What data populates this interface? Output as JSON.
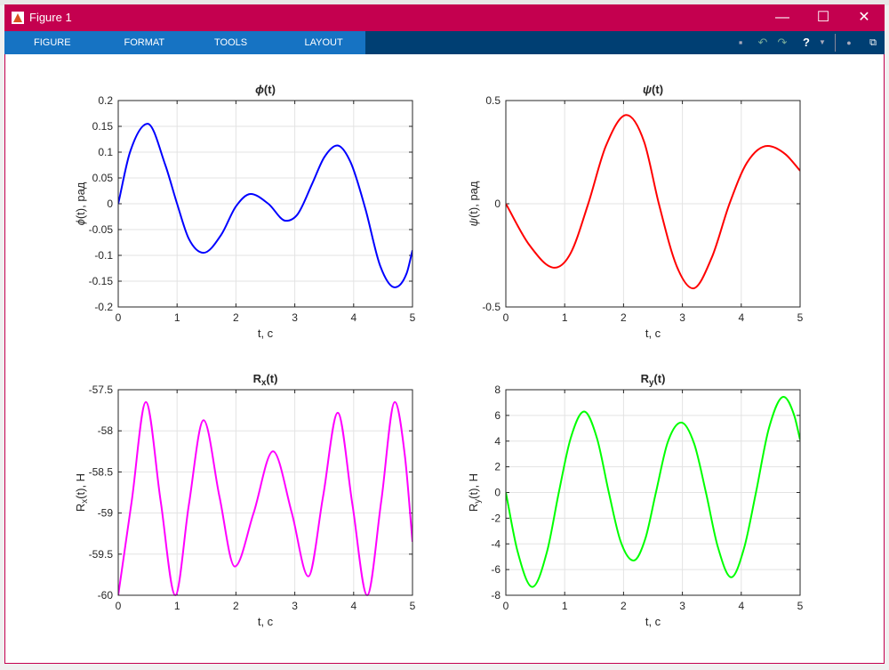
{
  "window": {
    "title": "Figure 1",
    "minimize": "—",
    "maximize": "☐",
    "close": "✕"
  },
  "toolstrip": {
    "tabs": [
      "FIGURE",
      "FORMAT",
      "TOOLS",
      "LAYOUT"
    ],
    "icons": [
      "save-icon",
      "undo-icon",
      "redo-icon",
      "help-icon",
      "dropdown-icon",
      "dock-icon"
    ]
  },
  "colors": {
    "phi": "#0000FF",
    "psi": "#FF0000",
    "rx": "#FF00FF",
    "ry": "#00FF00",
    "titlebar": "#C4004F"
  },
  "chart_data": [
    {
      "type": "line",
      "title": {
        "main": "ϕ",
        "sub": "",
        "tail": "(t)"
      },
      "xlabel": "t, c",
      "ylabel": {
        "main": "ϕ",
        "sub": "",
        "tail": "(t),  рад"
      },
      "xlim": [
        0,
        5
      ],
      "ylim": [
        -0.2,
        0.2
      ],
      "grid": true,
      "xticks": [
        0,
        1,
        2,
        3,
        4,
        5
      ],
      "xtick_labels": [
        "0",
        "1",
        "2",
        "3",
        "4",
        "5"
      ],
      "yticks": [
        -0.2,
        -0.15,
        -0.1,
        -0.05,
        0,
        0.05,
        0.1,
        0.15,
        0.2
      ],
      "ytick_labels": [
        "-0.2",
        "-0.15",
        "-0.1",
        "-0.05",
        "0",
        "0.05",
        "0.1",
        "0.15",
        "0.2"
      ],
      "color_key": "phi",
      "points": [
        [
          0,
          0
        ],
        [
          0.2,
          0.1
        ],
        [
          0.5,
          0.155
        ],
        [
          0.8,
          0.075
        ],
        [
          1.0,
          0.0
        ],
        [
          1.2,
          -0.068
        ],
        [
          1.45,
          -0.095
        ],
        [
          1.75,
          -0.06
        ],
        [
          2.0,
          -0.005
        ],
        [
          2.25,
          0.019
        ],
        [
          2.55,
          0.0
        ],
        [
          2.85,
          -0.033
        ],
        [
          3.05,
          -0.02
        ],
        [
          3.3,
          0.04
        ],
        [
          3.5,
          0.09
        ],
        [
          3.72,
          0.113
        ],
        [
          3.95,
          0.08
        ],
        [
          4.2,
          -0.01
        ],
        [
          4.45,
          -0.12
        ],
        [
          4.7,
          -0.162
        ],
        [
          4.9,
          -0.135
        ],
        [
          5,
          -0.09
        ]
      ]
    },
    {
      "type": "line",
      "title": {
        "main": "ψ",
        "sub": "",
        "tail": "(t)"
      },
      "xlabel": "t, c",
      "ylabel": {
        "main": "ψ",
        "sub": "",
        "tail": "(t),  рад"
      },
      "xlim": [
        0,
        5
      ],
      "ylim": [
        -0.5,
        0.5
      ],
      "grid": true,
      "xticks": [
        0,
        1,
        2,
        3,
        4,
        5
      ],
      "xtick_labels": [
        "0",
        "1",
        "2",
        "3",
        "4",
        "5"
      ],
      "yticks": [
        -0.5,
        0,
        0.5
      ],
      "ytick_labels": [
        "-0.5",
        "0",
        "0.5"
      ],
      "color_key": "psi",
      "points": [
        [
          0,
          0
        ],
        [
          0.4,
          -0.2
        ],
        [
          0.83,
          -0.31
        ],
        [
          1.1,
          -0.24
        ],
        [
          1.4,
          0
        ],
        [
          1.7,
          0.28
        ],
        [
          2.05,
          0.43
        ],
        [
          2.35,
          0.3
        ],
        [
          2.6,
          0
        ],
        [
          2.9,
          -0.3
        ],
        [
          3.18,
          -0.41
        ],
        [
          3.5,
          -0.26
        ],
        [
          3.8,
          0
        ],
        [
          4.1,
          0.2
        ],
        [
          4.45,
          0.28
        ],
        [
          4.75,
          0.24
        ],
        [
          5,
          0.16
        ]
      ]
    },
    {
      "type": "line",
      "title": {
        "main": "R",
        "sub": "x",
        "tail": "(t)"
      },
      "xlabel": "t, c",
      "ylabel": {
        "main": "R",
        "sub": "x",
        "tail": "(t),  Н"
      },
      "xlim": [
        0,
        5
      ],
      "ylim": [
        -60,
        -57.5
      ],
      "grid": true,
      "xticks": [
        0,
        1,
        2,
        3,
        4,
        5
      ],
      "xtick_labels": [
        "0",
        "1",
        "2",
        "3",
        "4",
        "5"
      ],
      "yticks": [
        -60,
        -59.5,
        -59,
        -58.5,
        -58,
        -57.5
      ],
      "ytick_labels": [
        "-60",
        "-59.5",
        "-59",
        "-58.5",
        "-58",
        "-57.5"
      ],
      "color_key": "rx",
      "points": [
        [
          0,
          -60
        ],
        [
          0.23,
          -58.85
        ],
        [
          0.47,
          -57.65
        ],
        [
          0.72,
          -58.85
        ],
        [
          0.97,
          -60
        ],
        [
          1.2,
          -58.9
        ],
        [
          1.45,
          -57.87
        ],
        [
          1.72,
          -58.8
        ],
        [
          1.98,
          -59.65
        ],
        [
          2.3,
          -59.0
        ],
        [
          2.63,
          -58.25
        ],
        [
          2.95,
          -59.0
        ],
        [
          3.23,
          -59.77
        ],
        [
          3.48,
          -58.8
        ],
        [
          3.73,
          -57.78
        ],
        [
          3.98,
          -58.9
        ],
        [
          4.23,
          -60
        ],
        [
          4.47,
          -58.85
        ],
        [
          4.7,
          -57.65
        ],
        [
          4.87,
          -58.3
        ],
        [
          5,
          -59.35
        ]
      ]
    },
    {
      "type": "line",
      "title": {
        "main": "R",
        "sub": "y",
        "tail": "(t)"
      },
      "xlabel": "t, c",
      "ylabel": {
        "main": "R",
        "sub": "y",
        "tail": "(t),  Н"
      },
      "xlim": [
        0,
        5
      ],
      "ylim": [
        -8,
        8
      ],
      "grid": true,
      "xticks": [
        0,
        1,
        2,
        3,
        4,
        5
      ],
      "xtick_labels": [
        "0",
        "1",
        "2",
        "3",
        "4",
        "5"
      ],
      "yticks": [
        -8,
        -6,
        -4,
        -2,
        0,
        2,
        4,
        6,
        8
      ],
      "ytick_labels": [
        "-8",
        "-6",
        "-4",
        "-2",
        "0",
        "2",
        "4",
        "6",
        "8"
      ],
      "color_key": "ry",
      "points": [
        [
          0,
          0
        ],
        [
          0.2,
          -4.6
        ],
        [
          0.45,
          -7.35
        ],
        [
          0.7,
          -4.6
        ],
        [
          0.9,
          0
        ],
        [
          1.1,
          4.2
        ],
        [
          1.33,
          6.3
        ],
        [
          1.55,
          4.2
        ],
        [
          1.75,
          0
        ],
        [
          1.95,
          -3.8
        ],
        [
          2.17,
          -5.3
        ],
        [
          2.37,
          -3.6
        ],
        [
          2.55,
          0
        ],
        [
          2.75,
          3.9
        ],
        [
          2.98,
          5.45
        ],
        [
          3.2,
          3.8
        ],
        [
          3.4,
          0
        ],
        [
          3.6,
          -4.2
        ],
        [
          3.83,
          -6.6
        ],
        [
          4.05,
          -4.3
        ],
        [
          4.25,
          0
        ],
        [
          4.47,
          5.0
        ],
        [
          4.72,
          7.45
        ],
        [
          4.9,
          6.0
        ],
        [
          5,
          4.1
        ]
      ]
    }
  ]
}
